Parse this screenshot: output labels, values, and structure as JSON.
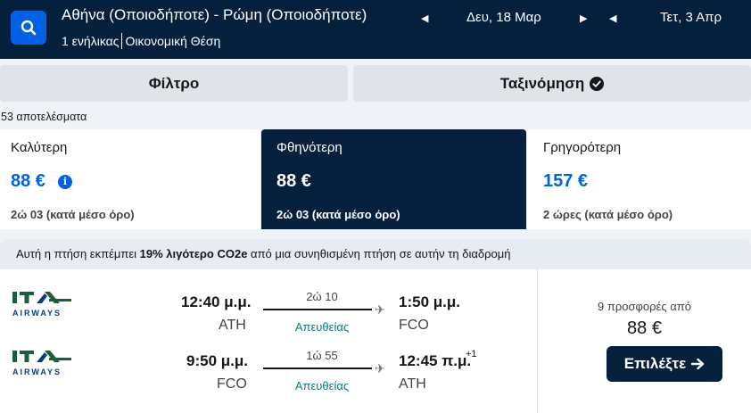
{
  "header": {
    "route": "Αθήνα (Οποιοδήποτε) - Ρώμη (Οποιοδήποτε)",
    "travellers": "1 ενήλικας",
    "cabin": "Οικονομική Θέση",
    "depart_date": "Δευ, 18 Μαρ",
    "return_date": "Τετ, 3 Απρ",
    "icons": {
      "search": "search-icon",
      "prev": "caret-left-icon",
      "next": "caret-right-icon"
    }
  },
  "controls": {
    "filter_label": "Φίλτρο",
    "sort_label": "Ταξινόμηση",
    "sort_icon": "check-circle-icon"
  },
  "results_count": "53 αποτελέσματα",
  "summary": [
    {
      "label": "Καλύτερη",
      "price": "88 €",
      "duration": "2ώ 03 (κατά μέσο όρο)",
      "info_icon": "i"
    },
    {
      "label": "Φθηνότερη",
      "price": "88 €",
      "duration": "2ώ 03 (κατά μέσο όρο)"
    },
    {
      "label": "Γρηγορότερη",
      "price": "157 €",
      "duration": "2 ώρες (κατά μέσο όρο)"
    }
  ],
  "eco": {
    "pre": "Αυτή η πτήση εκπέμπει ",
    "highlight": "19% λιγότερο CO2e",
    "post": " από μια συνηθισμένη πτήση σε αυτήν τη διαδρομή"
  },
  "flight": {
    "airline_logo": "ita-airways-logo",
    "airline_text_top": "ITA",
    "airline_text_bottom": "AIRWAYS",
    "outbound": {
      "depart_time": "12:40 μ.μ.",
      "depart_code": "ATH",
      "duration": "2ώ 10",
      "stops": "Απευθείας",
      "arrive_time": "1:50 μ.μ.",
      "arrive_code": "FCO"
    },
    "inbound": {
      "depart_time": "9:50 μ.μ.",
      "depart_code": "FCO",
      "duration": "1ώ 55",
      "stops": "Απευθείας",
      "arrive_time": "12:45 π.μ.",
      "day_offset": "+1",
      "arrive_code": "ATH"
    },
    "offers": "9 προσφορές από",
    "price": "88 €",
    "select_label": "Επιλέξτε"
  },
  "colors": {
    "header_bg": "#05203c",
    "accent_blue": "#0062e3",
    "stop_teal": "#0a7d7f",
    "logo_green": "#1b5e3a",
    "logo_blue": "#0d3b7a"
  }
}
